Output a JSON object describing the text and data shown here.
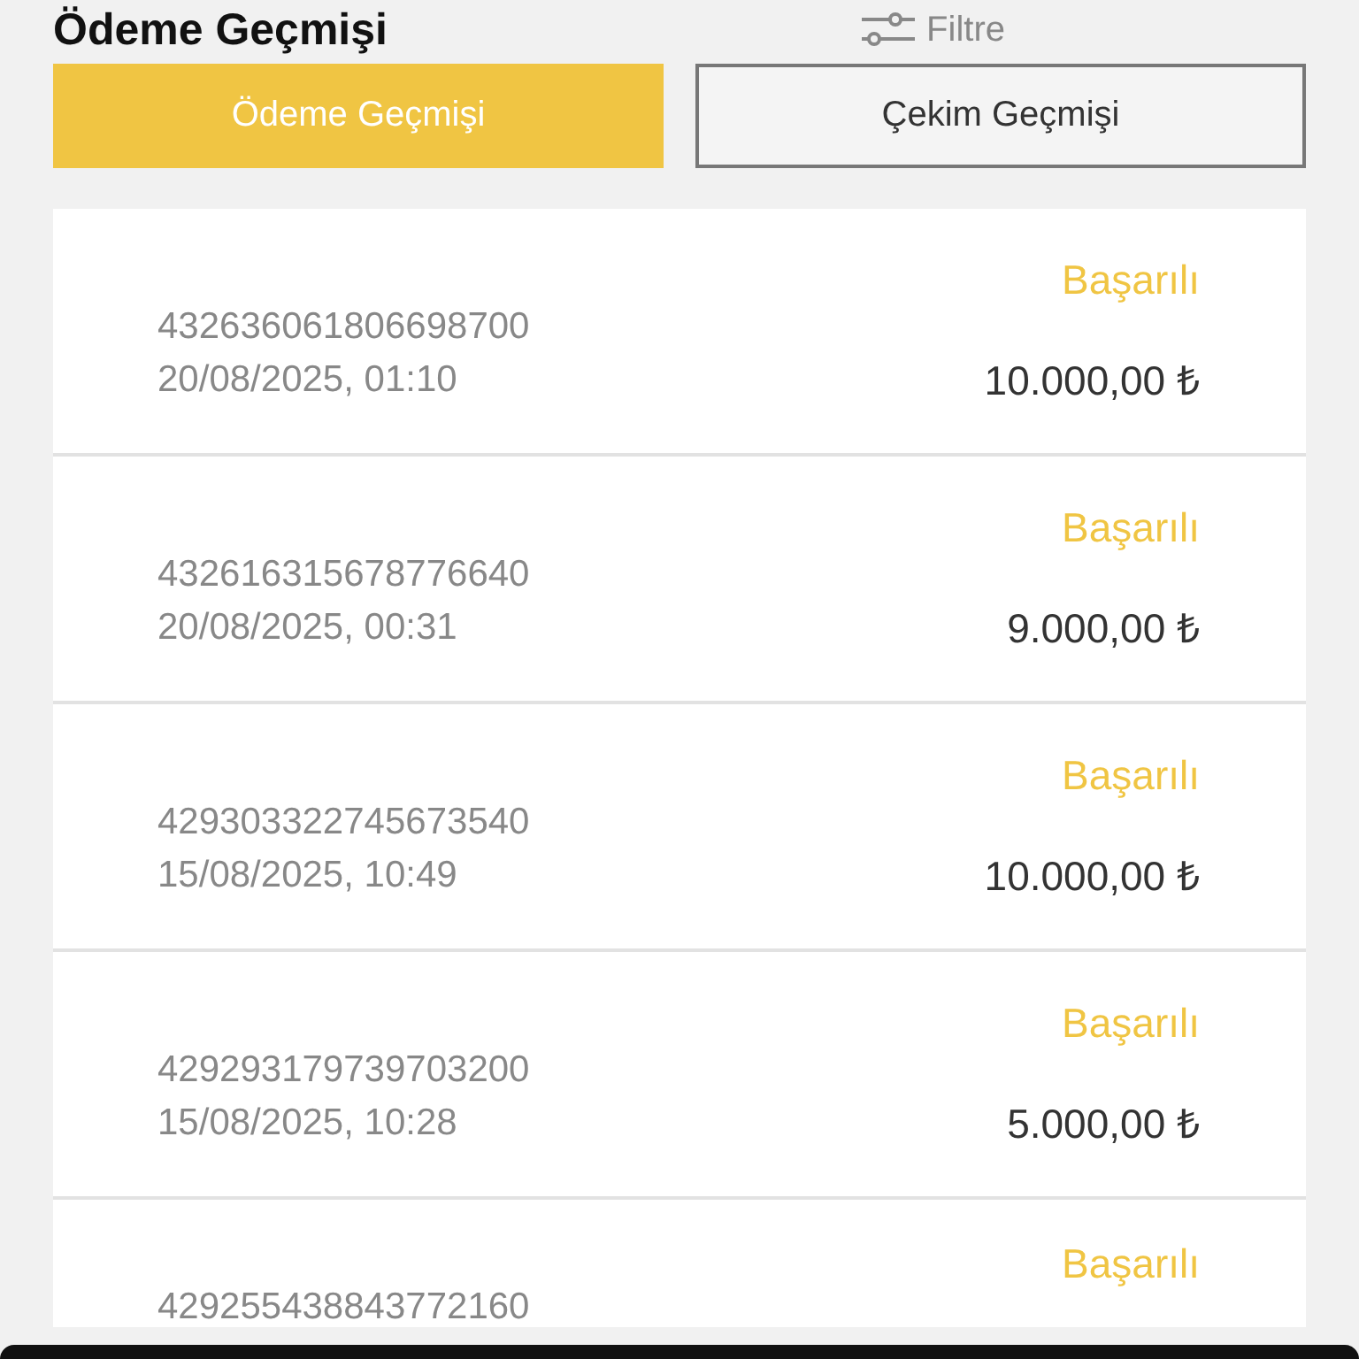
{
  "header": {
    "title": "Ödeme Geçmişi",
    "filter_label": "Filtre"
  },
  "tabs": [
    {
      "label": "Ödeme Geçmişi",
      "selected": true
    },
    {
      "label": "Çekim Geçmişi",
      "selected": false
    }
  ],
  "payments": [
    {
      "status": "Başarılı",
      "id": "432636061806698700",
      "datetime": "20/08/2025, 01:10",
      "amount": "10.000,00 ₺"
    },
    {
      "status": "Başarılı",
      "id": "432616315678776640",
      "datetime": "20/08/2025, 00:31",
      "amount": "9.000,00 ₺"
    },
    {
      "status": "Başarılı",
      "id": "429303322745673540",
      "datetime": "15/08/2025, 10:49",
      "amount": "10.000,00 ₺"
    },
    {
      "status": "Başarılı",
      "id": "429293179739703200",
      "datetime": "15/08/2025, 10:28",
      "amount": "5.000,00 ₺"
    },
    {
      "status": "Başarılı",
      "id": "429255438843772160"
    }
  ]
}
